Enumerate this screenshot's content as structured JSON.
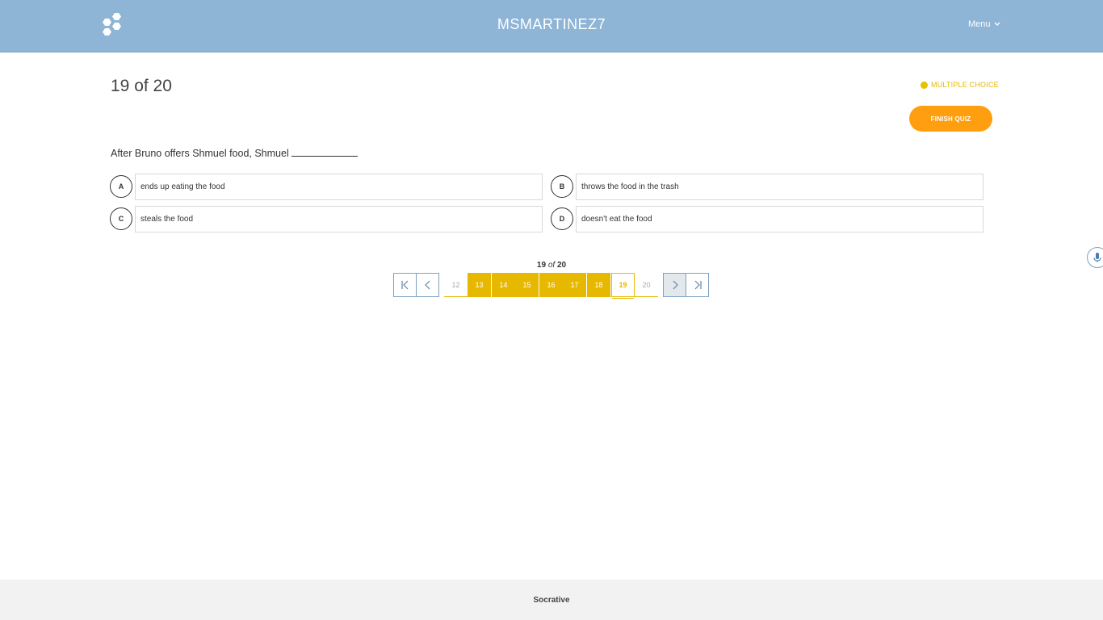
{
  "header": {
    "room_name": "MSMARTINEZ7",
    "menu_label": "Menu",
    "logo_icon": "socrative-hexagon-logo",
    "menu_icon": "chevron-down-icon"
  },
  "quiz": {
    "counter": "19 of 20",
    "question_type": "MULTIPLE CHOICE",
    "finish_label": "FINISH QUIZ",
    "question_text": "After Bruno offers Shmuel food, Shmuel",
    "choices": [
      {
        "letter": "A",
        "text": "ends up eating the food"
      },
      {
        "letter": "B",
        "text": "throws the food in the trash"
      },
      {
        "letter": "C",
        "text": "steals the food"
      },
      {
        "letter": "D",
        "text": "doesn't eat the food"
      }
    ]
  },
  "pager": {
    "current": "19",
    "of_word": "of",
    "total": "20",
    "pages": [
      "12",
      "13",
      "14",
      "15",
      "16",
      "17",
      "18",
      "19",
      "20"
    ],
    "icons": {
      "first": "first-page-icon",
      "prev": "chevron-left-icon",
      "next": "chevron-right-icon",
      "last": "last-page-icon"
    }
  },
  "footer": {
    "brand": "Socrative"
  },
  "colors": {
    "header_bg": "#8eb4d6",
    "accent_yellow": "#e6b800",
    "finish_orange": "#ff9f0f"
  }
}
